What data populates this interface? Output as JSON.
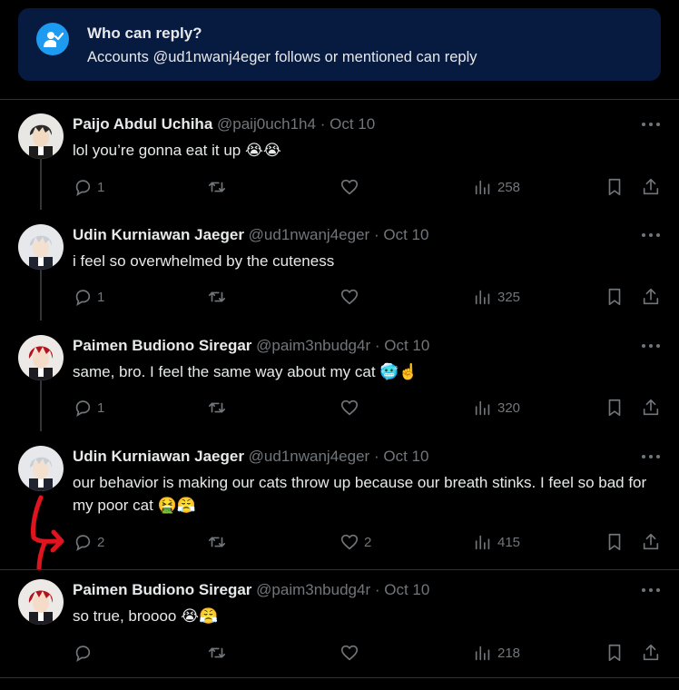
{
  "banner": {
    "title": "Who can reply?",
    "subtitle": "Accounts @ud1nwanj4eger follows or mentioned can reply",
    "icon": "person-check-icon"
  },
  "tweets": [
    {
      "name": "Paijo Abdul Uchiha",
      "handle": "@paij0uch1h4",
      "sep": "·",
      "date": "Oct 10",
      "text": "lol you’re gonna eat it up 😭😭",
      "replies": "1",
      "retweets": "",
      "likes": "",
      "views": "258",
      "avatar_hair": "#2b2b2b"
    },
    {
      "name": "Udin Kurniawan Jaeger",
      "handle": "@ud1nwanj4eger",
      "sep": "·",
      "date": "Oct 10",
      "text": "i feel so overwhelmed by the cuteness",
      "replies": "1",
      "retweets": "",
      "likes": "",
      "views": "325",
      "avatar_hair": "#c9ced6"
    },
    {
      "name": "Paimen Budiono Siregar",
      "handle": "@paim3nbudg4r",
      "sep": "·",
      "date": "Oct 10",
      "text": "same, bro. I feel the same way about my cat 🥶☝️",
      "replies": "1",
      "retweets": "",
      "likes": "",
      "views": "320",
      "avatar_hair": "#b3141b"
    },
    {
      "name": "Udin Kurniawan Jaeger",
      "handle": "@ud1nwanj4eger",
      "sep": "·",
      "date": "Oct 10",
      "text": "our behavior is making our cats throw up because our breath stinks. I feel so bad for my poor cat 🤮😤",
      "replies": "2",
      "retweets": "",
      "likes": "2",
      "views": "415",
      "avatar_hair": "#c9ced6"
    },
    {
      "name": "Paimen Budiono Siregar",
      "handle": "@paim3nbudg4r",
      "sep": "·",
      "date": "Oct 10",
      "text": "so true, broooo 😭😤",
      "replies": "",
      "retweets": "",
      "likes": "",
      "views": "218",
      "avatar_hair": "#b3141b"
    }
  ],
  "colors": {
    "background": "#000000",
    "banner_bg": "#071a3f",
    "accent": "#1d9bf0",
    "muted": "#71767b",
    "annotation": "#e0141e"
  },
  "icons": [
    "reply-icon",
    "retweet-icon",
    "like-icon",
    "views-icon",
    "bookmark-icon",
    "share-icon",
    "more-icon"
  ]
}
